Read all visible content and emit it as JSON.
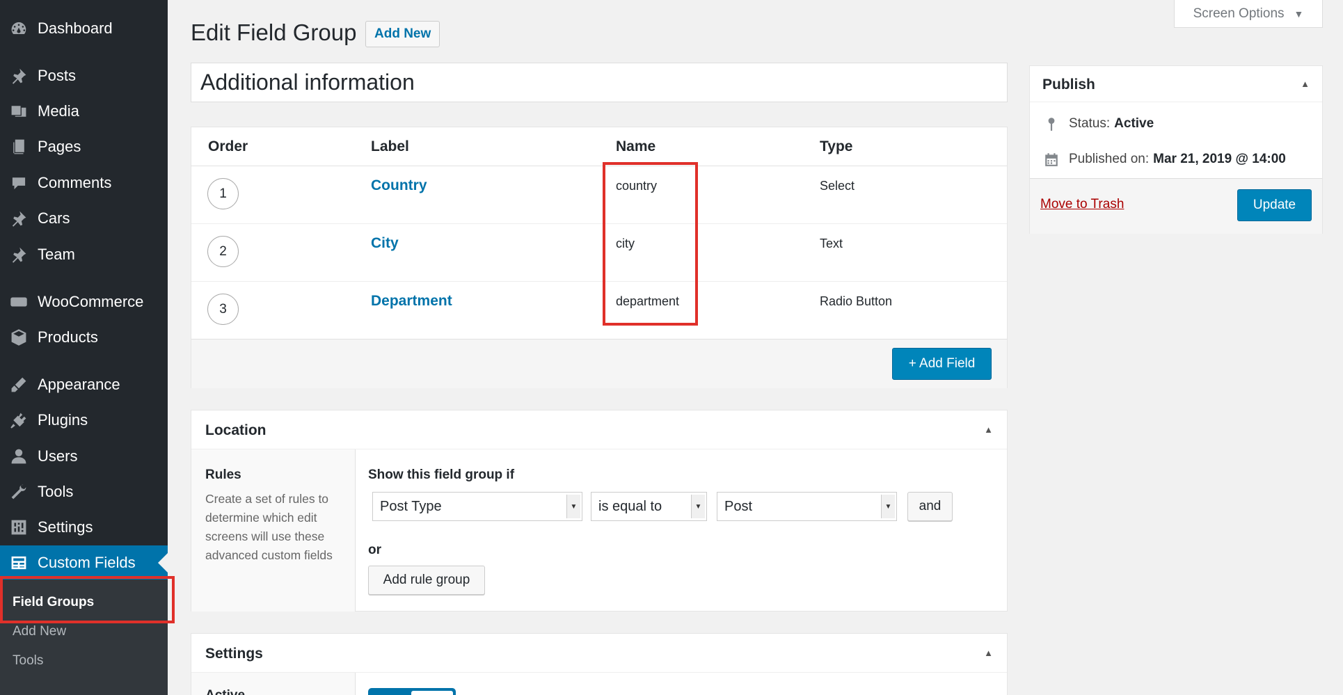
{
  "sidebar": {
    "items": [
      {
        "label": "Dashboard",
        "icon": "dashboard-icon"
      },
      {
        "label": "Posts",
        "icon": "pin-icon"
      },
      {
        "label": "Media",
        "icon": "media-icon"
      },
      {
        "label": "Pages",
        "icon": "pages-icon"
      },
      {
        "label": "Comments",
        "icon": "comments-icon"
      },
      {
        "label": "Cars",
        "icon": "pin-icon"
      },
      {
        "label": "Team",
        "icon": "pin-icon"
      },
      {
        "label": "WooCommerce",
        "icon": "woocommerce-icon"
      },
      {
        "label": "Products",
        "icon": "products-icon"
      },
      {
        "label": "Appearance",
        "icon": "appearance-icon"
      },
      {
        "label": "Plugins",
        "icon": "plugins-icon"
      },
      {
        "label": "Users",
        "icon": "users-icon"
      },
      {
        "label": "Tools",
        "icon": "tools-icon"
      },
      {
        "label": "Settings",
        "icon": "settings-icon"
      },
      {
        "label": "Custom Fields",
        "icon": "custom-fields-icon"
      }
    ],
    "submenu": [
      "Field Groups",
      "Add New",
      "Tools"
    ]
  },
  "header": {
    "title": "Edit Field Group",
    "add_new": "Add New",
    "screen_options": "Screen Options"
  },
  "title_input": "Additional information",
  "fields": {
    "columns": [
      "Order",
      "Label",
      "Name",
      "Type"
    ],
    "rows": [
      {
        "order": "1",
        "label": "Country",
        "name": "country",
        "type": "Select"
      },
      {
        "order": "2",
        "label": "City",
        "name": "city",
        "type": "Text"
      },
      {
        "order": "3",
        "label": "Department",
        "name": "department",
        "type": "Radio Button"
      }
    ],
    "add_field": "+ Add Field"
  },
  "location": {
    "title": "Location",
    "rules_title": "Rules",
    "rules_desc": "Create a set of rules to determine which edit screens will use these advanced custom fields",
    "show_if": "Show this field group if",
    "param": "Post Type",
    "operator": "is equal to",
    "value": "Post",
    "and": "and",
    "or": "or",
    "add_rule_group": "Add rule group"
  },
  "settings": {
    "title": "Settings",
    "active": "Active"
  },
  "publish": {
    "title": "Publish",
    "status_label": "Status:",
    "status_value": "Active",
    "published_label": "Published on:",
    "published_value": "Mar 21, 2019 @ 14:00",
    "trash": "Move to Trash",
    "update": "Update"
  },
  "colors": {
    "sidebar_bg": "#23282d",
    "accent": "#0073aa",
    "highlight": "#e0302a"
  }
}
